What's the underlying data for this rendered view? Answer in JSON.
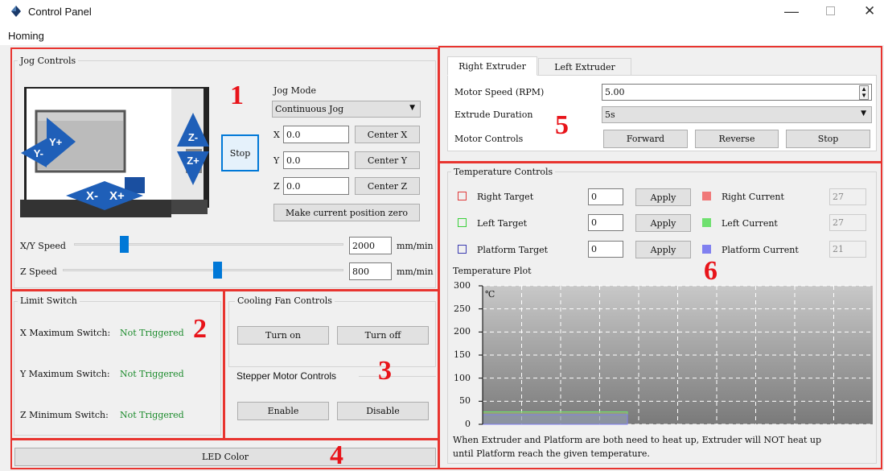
{
  "window": {
    "title": "Control Panel"
  },
  "menu": {
    "homing": "Homing"
  },
  "jog": {
    "title": "Jog Controls",
    "stop": "Stop",
    "mode_label": "Jog Mode",
    "mode_value": "Continuous Jog",
    "axes": [
      {
        "label": "X",
        "value": "0.0",
        "center": "Center X"
      },
      {
        "label": "Y",
        "value": "0.0",
        "center": "Center Y"
      },
      {
        "label": "Z",
        "value": "0.0",
        "center": "Center Z"
      }
    ],
    "make_zero": "Make current position zero",
    "xy_speed": {
      "label": "X/Y Speed",
      "value": "2000",
      "unit": "mm/min",
      "level": 0.16
    },
    "z_speed": {
      "label": "Z Speed",
      "value": "800",
      "unit": "mm/min",
      "level": 0.55
    },
    "printer_buttons": {
      "ym": "Y-",
      "yp": "Y+",
      "xm": "X-",
      "xp": "X+",
      "zm": "Z-",
      "zp": "Z+"
    }
  },
  "limit": {
    "title": "Limit Switch",
    "items": [
      {
        "label": "X Maximum Switch:",
        "status": "Not Triggered"
      },
      {
        "label": "Y Maximum Switch:",
        "status": "Not Triggered"
      },
      {
        "label": "Z Minimum Switch:",
        "status": "Not Triggered"
      }
    ]
  },
  "fan": {
    "title": "Cooling Fan Controls",
    "on": "Turn on",
    "off": "Turn off"
  },
  "stepper": {
    "title": "Stepper Motor Controls",
    "enable": "Enable",
    "disable": "Disable"
  },
  "led": {
    "label": "LED Color"
  },
  "extruder": {
    "tabs": [
      "Right Extruder",
      "Left Extruder"
    ],
    "speed_label": "Motor Speed (RPM)",
    "speed_value": "5.00",
    "duration_label": "Extrude Duration",
    "duration_value": "5s",
    "motor_label": "Motor Controls",
    "forward": "Forward",
    "reverse": "Reverse",
    "stop": "Stop"
  },
  "temp": {
    "title": "Temperature Controls",
    "rows": [
      {
        "target_label": "Right Target",
        "target_value": "0",
        "apply": "Apply",
        "current_label": "Right Current",
        "current_value": "27",
        "target_color": "#e03b3b",
        "current_color": "#f07878"
      },
      {
        "target_label": "Left Target",
        "target_value": "0",
        "apply": "Apply",
        "current_label": "Left Current",
        "current_value": "27",
        "target_color": "#3bcf3b",
        "current_color": "#6fe06f"
      },
      {
        "target_label": "Platform Target",
        "target_value": "0",
        "apply": "Apply",
        "current_label": "Platform Current",
        "current_value": "21",
        "target_color": "#3b3bb0",
        "current_color": "#8080f0"
      }
    ],
    "plot_label": "Temperature Plot",
    "unit": "℃",
    "yticks": [
      "300",
      "250",
      "200",
      "150",
      "100",
      "50",
      "0"
    ],
    "note_line1": "When Extruder and Platform are both need to heat up, Extruder will NOT heat up",
    "note_line2": "until Platform reach the given temperature."
  },
  "chart_data": {
    "type": "area",
    "ylim": [
      0,
      300
    ],
    "yticks": [
      0,
      50,
      100,
      150,
      200,
      250,
      300
    ],
    "ylabel": "℃",
    "grid": true,
    "series": [
      {
        "values": [
          27,
          27,
          27,
          27,
          27,
          27
        ],
        "color": "#f07878"
      },
      {
        "values": [
          27,
          27,
          27,
          27,
          27,
          27
        ],
        "color": "#6fe06f"
      },
      {
        "values": [
          21,
          21,
          21,
          21,
          21,
          21
        ],
        "color": "#8080f0"
      }
    ]
  },
  "annotations": [
    "1",
    "2",
    "3",
    "4",
    "5",
    "6"
  ]
}
